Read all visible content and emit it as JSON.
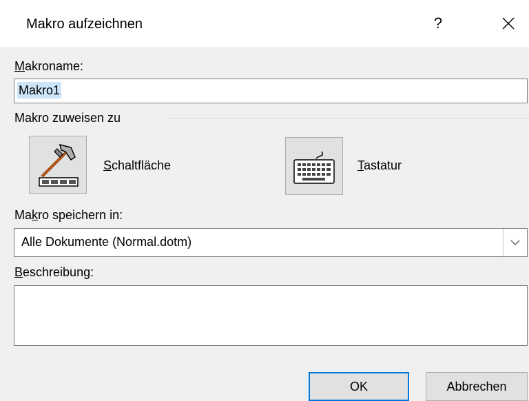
{
  "window": {
    "title": "Makro aufzeichnen",
    "help_label": "?",
    "close_icon": "close-icon"
  },
  "macro_name": {
    "label_accel": "M",
    "label_rest": "akroname:",
    "value": "Makro1"
  },
  "assign_group": {
    "label": "Makro zuweisen zu",
    "button_option": {
      "accel": "S",
      "rest": "chaltfläche",
      "icon": "hammer-button-icon"
    },
    "keyboard_option": {
      "accel": "T",
      "rest": "astatur",
      "icon": "keyboard-icon"
    }
  },
  "store_in": {
    "label_pre": "Ma",
    "label_accel": "k",
    "label_post": "ro speichern in:",
    "selected": "Alle Dokumente (Normal.dotm)"
  },
  "description": {
    "label_accel": "B",
    "label_rest": "eschreibung:",
    "value": ""
  },
  "buttons": {
    "ok": "OK",
    "cancel": "Abbrechen"
  },
  "colors": {
    "selection": "#cce4f7",
    "default_button_border": "#0078d7",
    "dialog_bg": "#f0f0f0"
  }
}
